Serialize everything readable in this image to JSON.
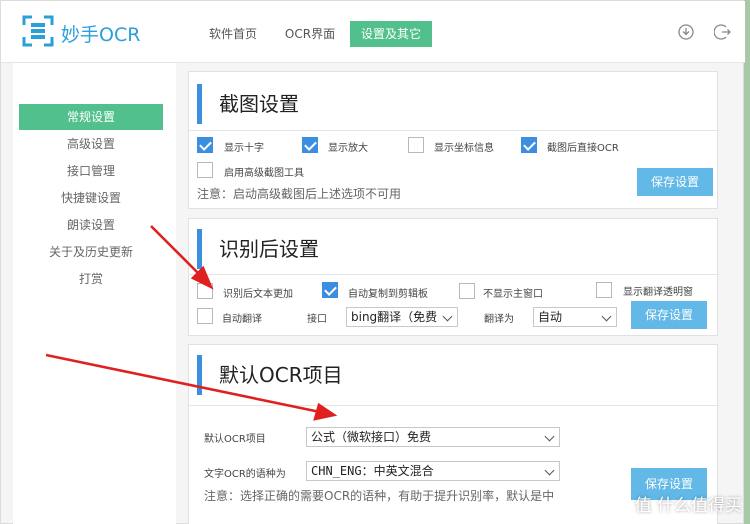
{
  "app": {
    "title": "妙手OCR"
  },
  "nav_tabs": [
    {
      "label": "软件首页"
    },
    {
      "label": "OCR界面"
    },
    {
      "label": "设置及其它"
    }
  ],
  "sidebar": {
    "items": [
      {
        "label": "常规设置"
      },
      {
        "label": "高级设置"
      },
      {
        "label": "接口管理"
      },
      {
        "label": "快捷键设置"
      },
      {
        "label": "朗读设置"
      },
      {
        "label": "关于及历史更新"
      },
      {
        "label": "打赏"
      }
    ]
  },
  "screenshot_settings": {
    "title": "截图设置",
    "options": [
      {
        "label": "显示十字",
        "checked": true
      },
      {
        "label": "显示放大",
        "checked": true
      },
      {
        "label": "显示坐标信息",
        "checked": false
      },
      {
        "label": "截图后直接OCR",
        "checked": true
      },
      {
        "label": "启用高级截图工具",
        "checked": false
      }
    ],
    "note": "注意：启动高级截图后上述选项不可用",
    "save_label": "保存设置"
  },
  "post_ocr_settings": {
    "title": "识别后设置",
    "options": [
      {
        "label": "识别后文本更加",
        "checked": false
      },
      {
        "label": "自动复制到剪辑板",
        "checked": true
      },
      {
        "label": "不显示主窗口",
        "checked": false
      },
      {
        "label": "显示翻译透明窗",
        "checked": false
      },
      {
        "label": "自动翻译",
        "checked": false
      }
    ],
    "interface_label": "接口",
    "interface_value": "bing翻译（免费",
    "translate_to_label": "翻译为",
    "translate_to_value": "自动",
    "save_label": "保存设置"
  },
  "default_ocr": {
    "title": "默认OCR项目",
    "project_label": "默认OCR项目",
    "project_value": "公式（微软接口）免费",
    "lang_label": "文字OCR的语种为",
    "lang_value": "CHN_ENG：中英文混合",
    "note": "注意：选择正确的需要OCR的语种，有助于提升识别率，默认是中",
    "save_label": "保存设置"
  },
  "watermark": "值 什么值得买",
  "colors": {
    "accent_green": "#52c08c",
    "accent_blue": "#3c8fe0",
    "button_blue": "#62b8e6",
    "arrow_red": "#e02020"
  }
}
